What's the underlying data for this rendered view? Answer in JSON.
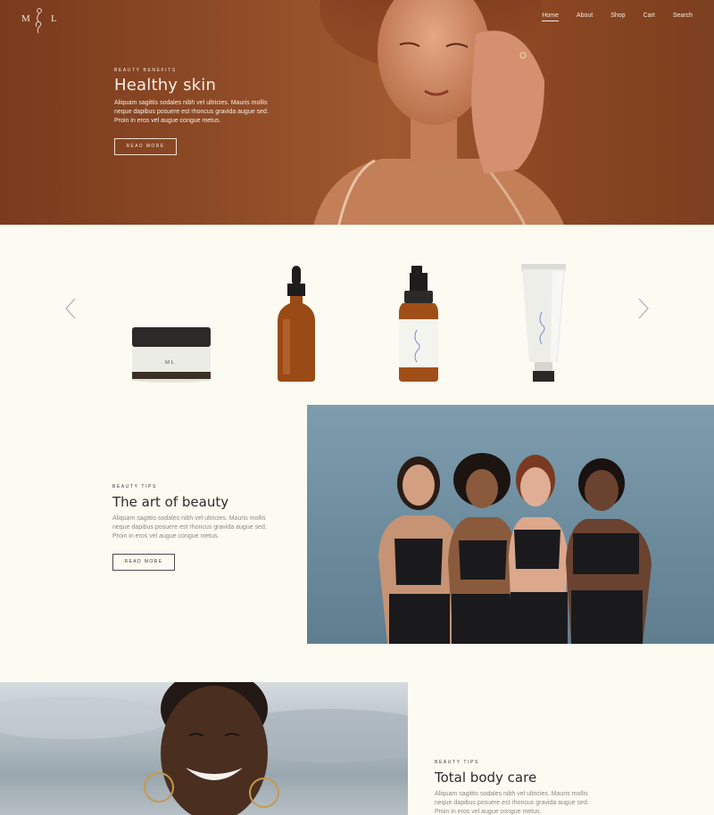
{
  "brand": {
    "logo_left": "M",
    "logo_right": "L"
  },
  "nav": {
    "items": [
      {
        "label": "Home",
        "active": true
      },
      {
        "label": "About"
      },
      {
        "label": "Shop"
      },
      {
        "label": "Cart"
      },
      {
        "label": "Search"
      }
    ]
  },
  "hero": {
    "eyebrow": "Beauty Benefits",
    "title": "Healthy skin",
    "body": "Aliquam sagittis sodales nibh vel ultricies. Mauris mollis neque dapibus posuere est rhoncus gravida augue sed. Proin in eros vel augue congue metus.",
    "button": "READ MORE"
  },
  "products": {
    "items": [
      {
        "name": "cream-jar",
        "label": "M L"
      },
      {
        "name": "dropper-bottle"
      },
      {
        "name": "spray-bottle"
      },
      {
        "name": "tube"
      }
    ]
  },
  "tips": {
    "eyebrow": "Beauty Tips",
    "title": "The art of beauty",
    "body": "Aliquam sagittis sodales nibh vel ultricies. Mauris mollis neque dapibus posuere est rhoncus gravida augue sed. Proin in eros vel augue congue metus.",
    "button": "READ MORE"
  },
  "body_care": {
    "eyebrow": "Beauty Tips",
    "title": "Total body care",
    "body": "Aliquam sagittis sodales nibh vel ultricies. Mauris mollis neque dapibus posuere est rhoncus gravida augue sed. Proin in eros vel augue congue metus."
  },
  "colors": {
    "hero_bg": "#8d4a26",
    "page_bg": "#fbfbf1",
    "photo_bg": "#6c8c9e",
    "amber_glass": "#9a4a14"
  }
}
